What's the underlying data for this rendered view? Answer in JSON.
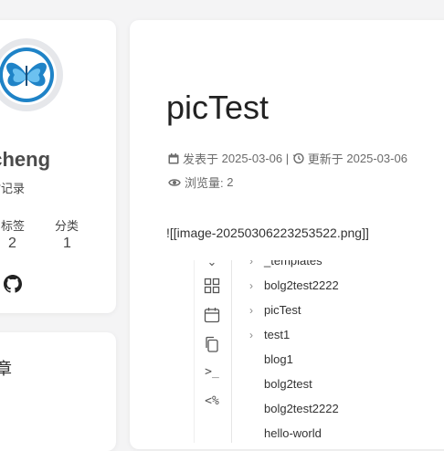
{
  "profile": {
    "author_name": "acheng",
    "subtitle": "时记录",
    "tags_label": "标签",
    "tags_count": "2",
    "categories_label": "分类",
    "categories_count": "1"
  },
  "recent": {
    "title": "章"
  },
  "post": {
    "title": "picTest",
    "published_label": "发表于",
    "published_date": "2025-03-06",
    "separator": "|",
    "updated_label": "更新于",
    "updated_date": "2025-03-06",
    "views_label": "浏览量:",
    "views_count": "2",
    "markdown_text": "![[image-20250306223253522.png]]"
  },
  "embedded": {
    "tree_items": [
      {
        "label": "_templates",
        "has_chevron": true
      },
      {
        "label": "bolg2test2222",
        "has_chevron": true
      },
      {
        "label": "picTest",
        "has_chevron": true
      },
      {
        "label": "test1",
        "has_chevron": true
      },
      {
        "label": "blog1",
        "has_chevron": false
      },
      {
        "label": "bolg2test",
        "has_chevron": false
      },
      {
        "label": "bolg2test2222",
        "has_chevron": false
      },
      {
        "label": "hello-world",
        "has_chevron": false
      }
    ],
    "rail_icons": [
      "chevron-icon",
      "blocks-icon",
      "calendar-icon",
      "copy-icon",
      "terminal-icon",
      "code-icon"
    ]
  }
}
